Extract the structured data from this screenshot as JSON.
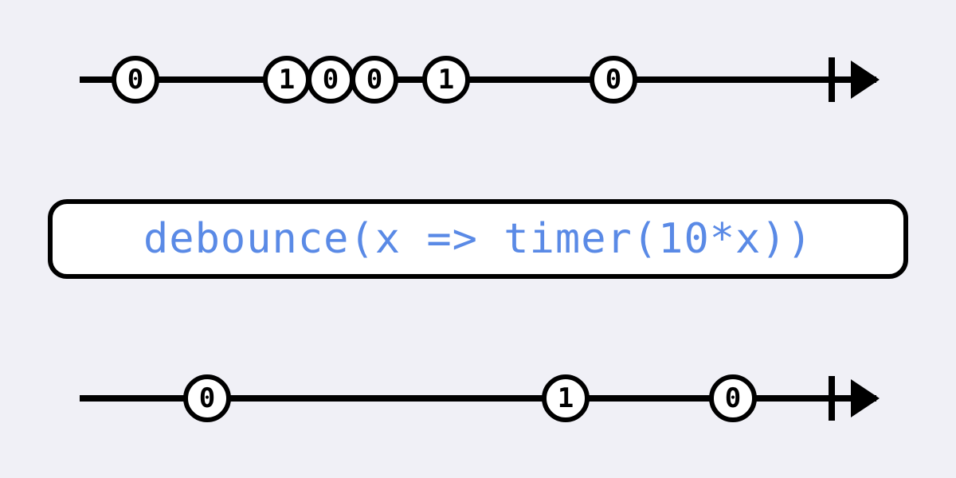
{
  "operator": {
    "label": "debounce(x => timer(10*x))"
  },
  "source": {
    "marbles": [
      {
        "t": 7,
        "v": "0"
      },
      {
        "t": 26,
        "v": "1"
      },
      {
        "t": 31.5,
        "v": "0"
      },
      {
        "t": 37,
        "v": "0"
      },
      {
        "t": 46,
        "v": "1"
      },
      {
        "t": 67,
        "v": "0"
      }
    ],
    "complete": 94
  },
  "output": {
    "marbles": [
      {
        "t": 16,
        "v": "0"
      },
      {
        "t": 61,
        "v": "1"
      },
      {
        "t": 82,
        "v": "0"
      }
    ],
    "complete": 94
  }
}
